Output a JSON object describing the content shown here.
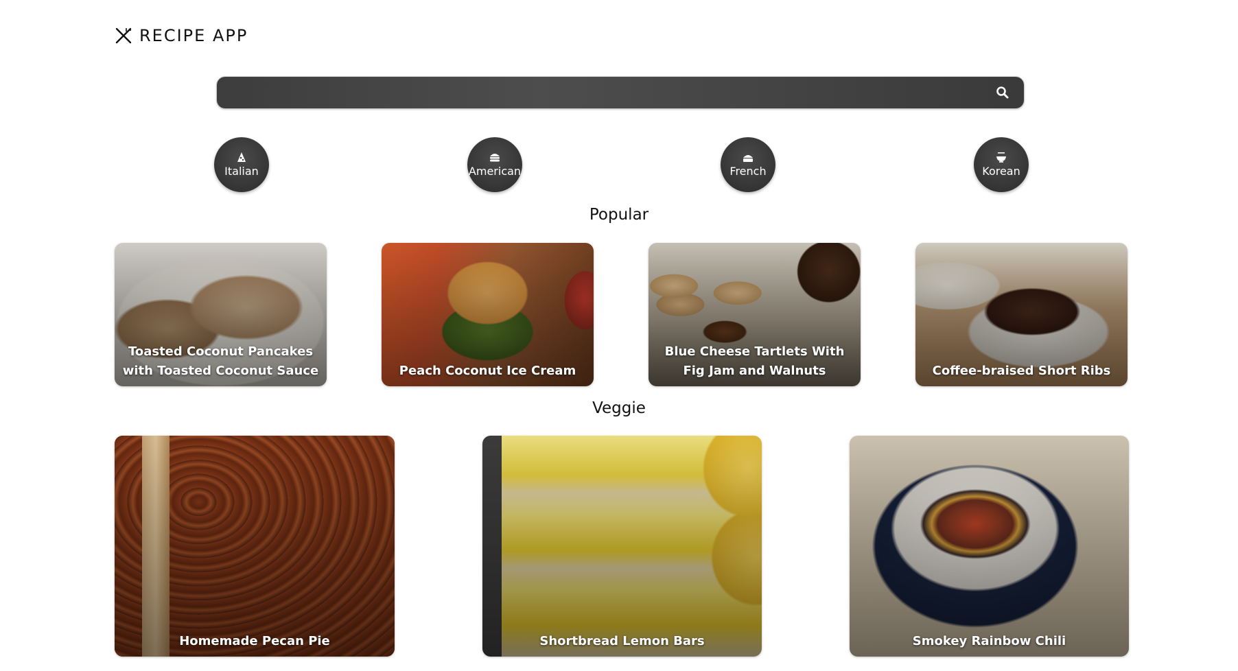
{
  "app": {
    "title": "RECIPE APP",
    "logo_icon": "fork-knife-icon"
  },
  "search": {
    "placeholder": "",
    "value": "",
    "icon": "search-icon"
  },
  "cuisines": [
    {
      "label": "Italian",
      "icon": "pizza-icon"
    },
    {
      "label": "American",
      "icon": "hamburger-icon"
    },
    {
      "label": "French",
      "icon": "cake-icon"
    },
    {
      "label": "Korean",
      "icon": "bowl-icon"
    }
  ],
  "sections": {
    "popular": {
      "title": "Popular",
      "recipes": [
        {
          "title": "Toasted Coconut Pancakes with Toasted Coconut Sauce"
        },
        {
          "title": "Peach Coconut Ice Cream"
        },
        {
          "title": "Blue Cheese Tartlets With Fig Jam and Walnuts"
        },
        {
          "title": "Coffee-braised Short Ribs"
        }
      ]
    },
    "veggie": {
      "title": "Veggie",
      "recipes": [
        {
          "title": "Homemade Pecan Pie"
        },
        {
          "title": "Shortbread Lemon Bars"
        },
        {
          "title": "Smokey Rainbow Chili"
        }
      ]
    }
  },
  "colors": {
    "accent_dark": "#313131",
    "background": "#ffffff",
    "text": "#111111"
  }
}
